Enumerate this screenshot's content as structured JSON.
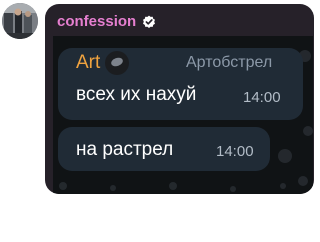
{
  "channel": {
    "name": "confession",
    "verified": true,
    "avatar_icon": "channel-avatar-photo",
    "name_color": "#e67fd0"
  },
  "forwarded_screenshot": {
    "sender": {
      "name": "Art",
      "signature": "Артобстрел",
      "name_color": "#f0a33f"
    },
    "messages": [
      {
        "text": "всех их нахуй",
        "time": "14:00"
      },
      {
        "text": "на растрел",
        "time": "14:00"
      }
    ]
  },
  "colors": {
    "card_background": "#262129",
    "bubble_background": "#202b36"
  }
}
